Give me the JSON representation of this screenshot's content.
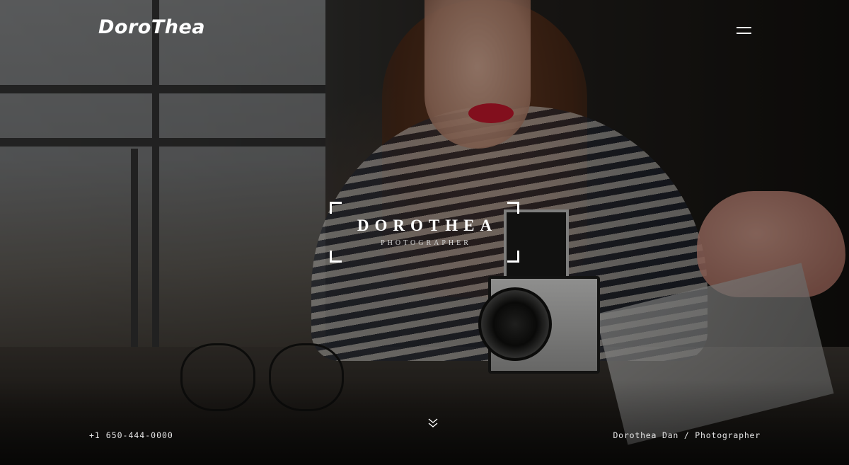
{
  "header": {
    "logo_text": "DoroThea",
    "menu_icon": "hamburger-menu-icon"
  },
  "hero": {
    "name": "DOROTHEA",
    "role": "PHOTOGRAPHER",
    "background_image": "woman-with-camera-photo",
    "scroll_icon": "double-chevron-down-icon"
  },
  "footer": {
    "phone": "+1 650-444-0000",
    "credit": "Dorothea Dan / Photographer"
  },
  "colors": {
    "text": "#ffffff",
    "overlay": "#0a0807",
    "lips_accent": "#c4132a"
  }
}
